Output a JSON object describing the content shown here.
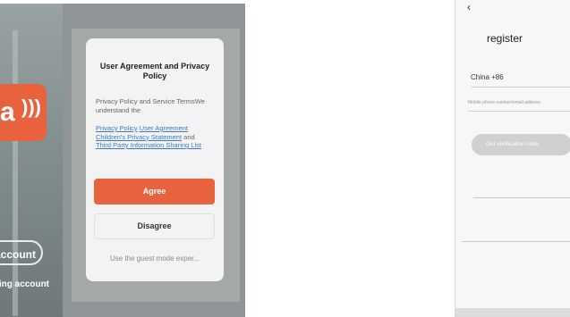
{
  "left_screen": {
    "logo": {
      "letter": "a",
      "icon": "wifi-waves-icon"
    },
    "account_button": "account",
    "existing_account_link": "sting account",
    "dialog": {
      "title": "User Agreement and Privacy Policy",
      "body": "Privacy Policy and Service TermsWe understand the",
      "links": {
        "privacy_policy": "Privacy Policy",
        "user_agreement": "User Agreement",
        "childrens_privacy": "Children's Privacy Statement",
        "and": "and",
        "third_party": "Third Party Information Sharing List"
      },
      "agree_label": "Agree",
      "disagree_label": "Disagree",
      "guest_mode_label": "Use the guest mode exper..."
    }
  },
  "right_screen": {
    "back_icon": "back-arrow-icon",
    "back_glyph": "‹",
    "title": "register",
    "country_value": "China +86",
    "phone_placeholder": "Mobile phone number/email address",
    "verification_button": "Get verification code"
  },
  "colors": {
    "accent": "#e8623e",
    "link": "#3a7bc8",
    "overlay": "#8f9496"
  }
}
